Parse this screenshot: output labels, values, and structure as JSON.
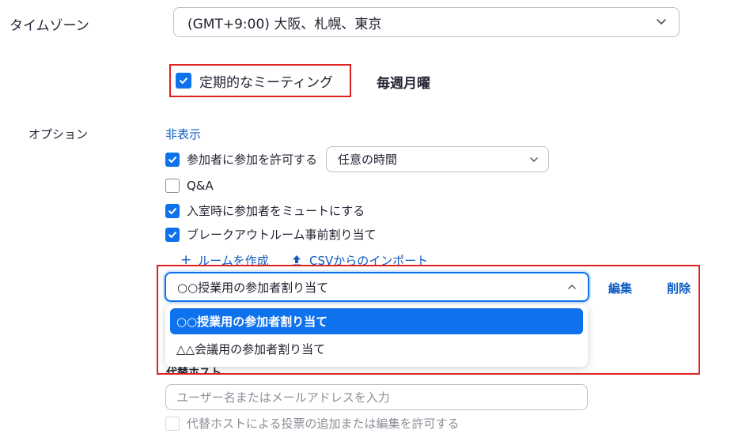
{
  "timezone": {
    "label": "タイムゾーン",
    "value": "(GMT+9:00) 大阪、札幌、東京"
  },
  "recurring": {
    "label": "定期的なミーティング",
    "checked": true,
    "frequency": "毎週月曜"
  },
  "options": {
    "label": "オプション",
    "hide_link": "非表示",
    "items": [
      {
        "label": "参加者に参加を許可する",
        "checked": true
      },
      {
        "label": "Q&A",
        "checked": false
      },
      {
        "label": "入室時に参加者をミュートにする",
        "checked": true
      },
      {
        "label": "ブレークアウトルーム事前割り当て",
        "checked": true
      }
    ],
    "join_time": "任意の時間"
  },
  "breakout": {
    "create_room": "ルームを作成",
    "import_csv": "CSVからのインポート",
    "selected": "○○授業用の参加者割り当て",
    "edit": "編集",
    "delete": "削除",
    "dropdown_options": [
      "○○授業用の参加者割り当て",
      "△△会議用の参加者割り当て"
    ]
  },
  "alternative_host": {
    "label": "代替ホスト",
    "placeholder": "ユーザー名またはメールアドレスを入力",
    "poll_permission": "代替ホストによる投票の追加または編集を許可する"
  },
  "colors": {
    "accent": "#0e72ed",
    "link": "#0e5cc4",
    "highlight_box": "#e02020"
  }
}
